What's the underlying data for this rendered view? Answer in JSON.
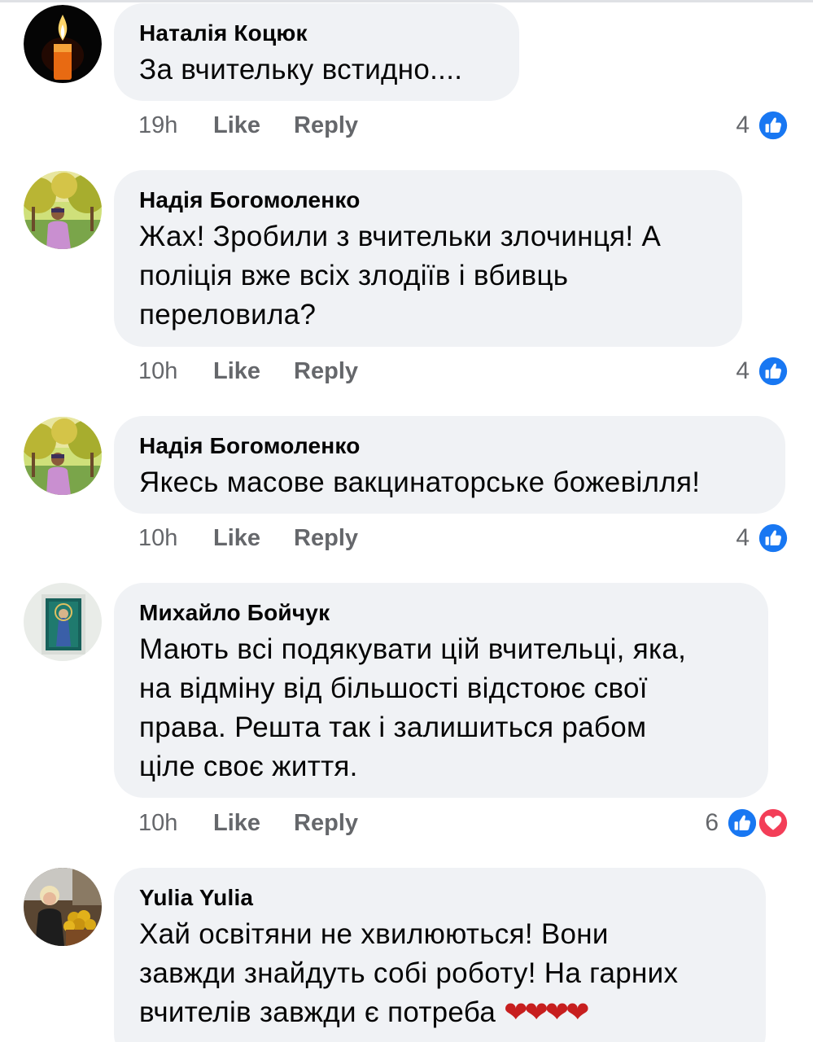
{
  "comments": [
    {
      "author": "Наталія Коцюк",
      "lines": [
        "За вчительку встидно...."
      ],
      "time": "19h",
      "like_label": "Like",
      "reply_label": "Reply",
      "reaction_count": "4",
      "reactions": [
        "like-icon"
      ]
    },
    {
      "author": "Надія Богомоленко",
      "lines": [
        "Жах! Зробили з вчительки злочинця! А",
        "поліція вже всіх злодіїв і вбивць",
        "переловила?"
      ],
      "time": "10h",
      "like_label": "Like",
      "reply_label": "Reply",
      "reaction_count": "4",
      "reactions": [
        "like-icon"
      ]
    },
    {
      "author": "Надія Богомоленко",
      "lines": [
        "Якесь масове вакцинаторське божевілля!"
      ],
      "time": "10h",
      "like_label": "Like",
      "reply_label": "Reply",
      "reaction_count": "4",
      "reactions": [
        "like-icon"
      ]
    },
    {
      "author": "Михайло Бойчук",
      "lines": [
        "Мають всі подякувати цій вчительці, яка,",
        "на відміну від більшості відстоює свої",
        "права. Решта так і залишиться рабом",
        "ціле своє життя."
      ],
      "time": "10h",
      "like_label": "Like",
      "reply_label": "Reply",
      "reaction_count": "6",
      "reactions": [
        "like-icon",
        "love-icon"
      ]
    },
    {
      "author": "Yulia Yulia",
      "lines": [
        "Хай освітяни не хвилюються! Вони",
        "завжди знайдуть собі роботу! На гарних",
        "вчителів завжди є потреба"
      ],
      "emoji": "❤❤❤❤"
    }
  ],
  "colors": {
    "bubble": "#f0f2f5",
    "meta_text": "#65676b",
    "like_blue": "#1877f2",
    "love_red": "#f33e58"
  }
}
